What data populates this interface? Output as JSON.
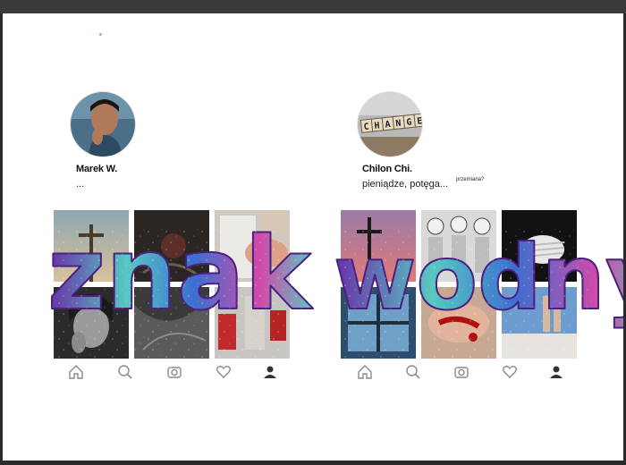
{
  "profiles": [
    {
      "name": "Marek W.",
      "bio": "...",
      "avatar_icon": "person-thinking-photo",
      "grid": [
        "sky-cross-photo",
        "dark-rose-photo",
        "hand-holding-paper-photo",
        "woman-portrait-bw-photo",
        "dark-hair-photo",
        "red-figure-photo"
      ]
    },
    {
      "name": "Chilon Chi.",
      "bio": "pieniądze, potęga...",
      "note": "przemiana?",
      "avatar_icon": "change-word-tiles-photo",
      "grid": [
        "cross-at-sunset-photo",
        "three-skeletons-photo",
        "bandaged-face-photo",
        "window-silhouette-photo",
        "bleeding-hand-photo",
        "blue-sky-hands-photo"
      ]
    }
  ],
  "nav_icons": [
    "home-icon",
    "search-icon",
    "camera-icon",
    "heart-icon",
    "profile-icon"
  ],
  "watermark": {
    "left_word": "znak",
    "right_word": "wodny"
  },
  "colors": {
    "glitter_purple": "#6a2ea8",
    "glitter_teal": "#57c9c2",
    "glitter_blue": "#3c6fd0",
    "glitter_pink": "#d24aa8"
  }
}
